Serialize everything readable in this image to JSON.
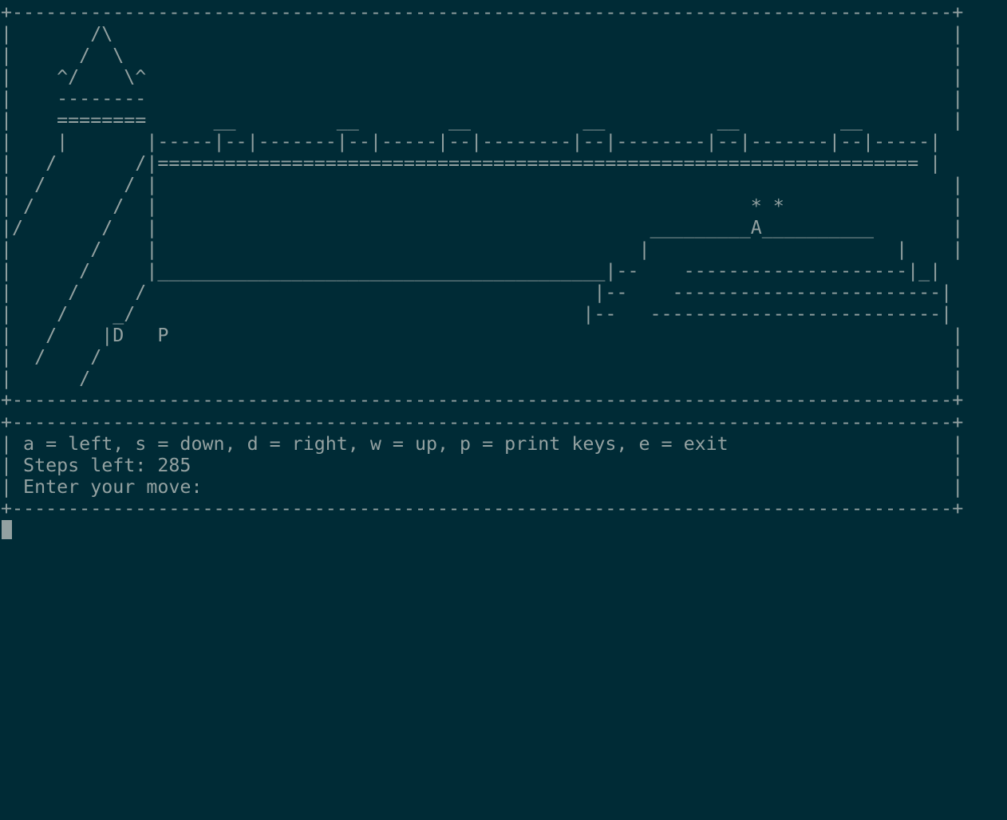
{
  "game": {
    "map_rows": [
      "+------------------------------------------------------------------------------------+",
      "|       /\\                                                                           |",
      "|      /  \\                                                                          |",
      "|    ^/    \\^                                                                        |",
      "|    --------                                                                        |",
      "|    ========      __         __        __          __          __         __        |",
      "|    |       |-----|--|-------|--|-----|--|--------|--|--------|--|-------|--|-----|",
      "|   /       /|==================================================================== |",
      "|  /       / |                                                                       |",
      "| /       /  |                                                     * *               |",
      "|/       /   |                                            _________A__________       |",
      "|       /    |                                           |                      |    |",
      "|      /     |________________________________________|--    --------------------|_|",
      "|     /     /                                        |--    ------------------------|",
      "|    /    _/                                        |--   --------------------------|",
      "|   /    |D   P                                                                      |",
      "|  /    /                                                                            |",
      "|      /                                                                             |",
      "+------------------------------------------------------------------------------------+"
    ],
    "player_glyph": "P",
    "door_glyph": "D",
    "goal_glyph": "A"
  },
  "status_panel": {
    "border_top": "+------------------------------------------------------------------------------------+",
    "controls": "| a = left, s = down, d = right, w = up, p = print keys, e = exit                    |",
    "steps_line": "| Steps left: 285                                                                    |",
    "prompt_line": "| Enter your move:                                                                   |",
    "border_bottom": "+------------------------------------------------------------------------------------+"
  },
  "colors": {
    "background": "#002b36",
    "foreground": "#93a1a1"
  }
}
